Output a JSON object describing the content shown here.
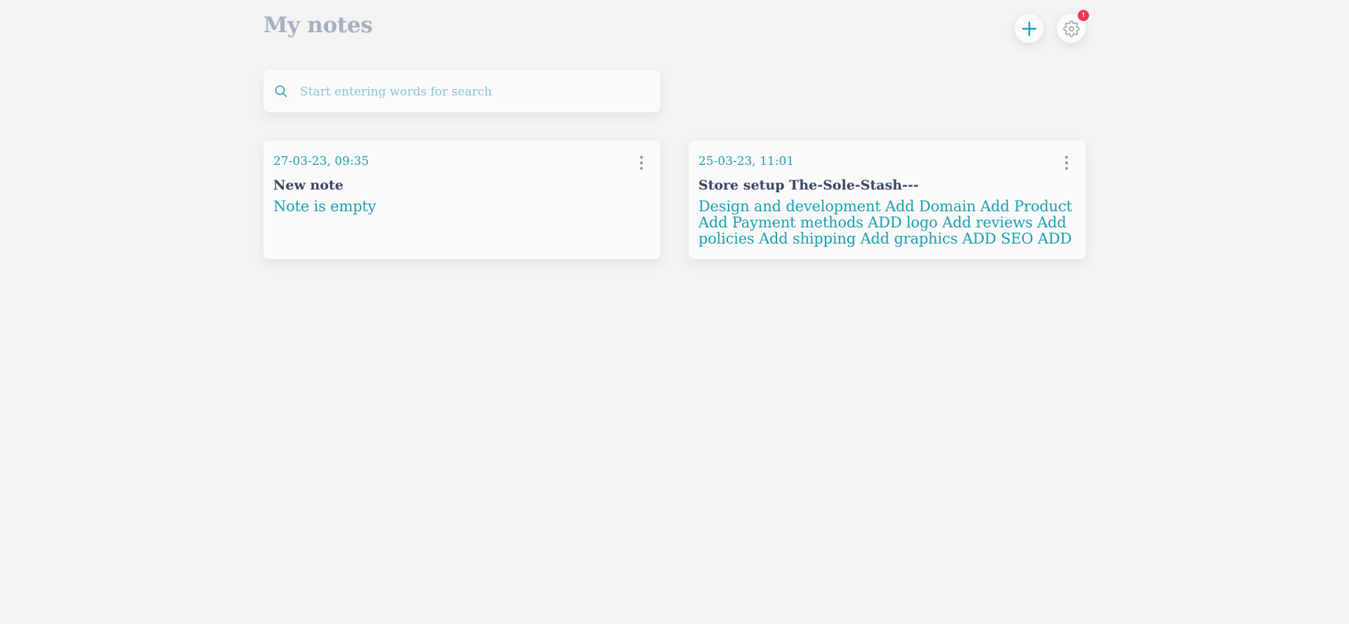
{
  "header": {
    "title": "My notes",
    "add_icon": "plus-icon",
    "settings_icon": "gear-icon",
    "notification_badge": "!"
  },
  "search": {
    "placeholder": "Start entering words for search",
    "value": "",
    "icon": "search-icon"
  },
  "notes": [
    {
      "date": "27-03-23, 09:35",
      "title": "New note",
      "body": "Note is empty"
    },
    {
      "date": "25-03-23, 11:01",
      "title": "Store setup The-Sole-Stash---",
      "body": "Design and development Add Domain Add Product Add Payment methods ADD logo Add reviews Add policies Add shipping Add graphics ADD SEO ADD"
    }
  ],
  "colors": {
    "accent": "#1a9fb2",
    "title_muted": "#a6b0c2",
    "note_title": "#3b4663",
    "badge": "#f0365a",
    "background": "#f3f3f3",
    "card": "#fafafa"
  }
}
